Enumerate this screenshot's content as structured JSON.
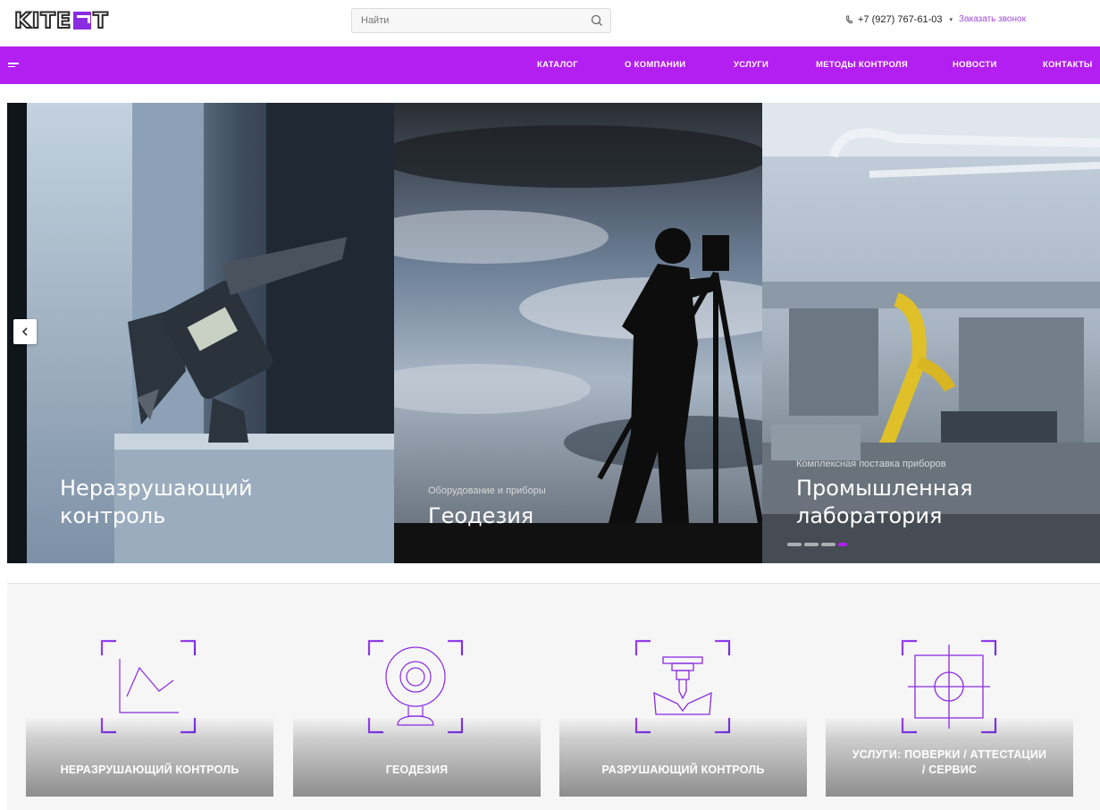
{
  "header": {
    "logo_text": "KITE",
    "logo_tail": "T",
    "search_placeholder": "Найти",
    "phone": "+7 (927) 767-61-03",
    "callback_label": "Заказать звонок"
  },
  "nav": {
    "items": [
      {
        "label": "КАТАЛОГ"
      },
      {
        "label": "О КОМПАНИИ"
      },
      {
        "label": "УСЛУГИ"
      },
      {
        "label": "МЕТОДЫ КОНТРОЛЯ"
      },
      {
        "label": "НОВОСТИ"
      },
      {
        "label": "КОНТАКТЫ"
      }
    ]
  },
  "slider": {
    "slides": [
      {
        "subtitle": "",
        "title_line1": "Неразрушающий",
        "title_line2": "контроль"
      },
      {
        "subtitle": "Оборудование и приборы",
        "title_line1": "Геодезия",
        "title_line2": ""
      },
      {
        "subtitle": "Комплексная поставка приборов",
        "title_line1": "Промышленная",
        "title_line2": "лаборатория"
      }
    ],
    "active_dot": 3,
    "dot_count": 4
  },
  "categories": [
    {
      "label": "НЕРАЗРУШАЮЩИЙ КОНТРОЛЬ",
      "icon": "chart-line-icon"
    },
    {
      "label": "ГЕОДЕЗИЯ",
      "icon": "webcam-icon"
    },
    {
      "label": "РАЗРУШАЮЩИЙ КОНТРОЛЬ",
      "icon": "press-icon"
    },
    {
      "label_line1": "УСЛУГИ: ПОВЕРКИ / АТТЕСТАЦИИ",
      "label_line2": "/ СЕРВИС",
      "icon": "target-icon"
    }
  ],
  "colors": {
    "accent": "#b21ff0",
    "icon_purple": "#8a2be2"
  }
}
